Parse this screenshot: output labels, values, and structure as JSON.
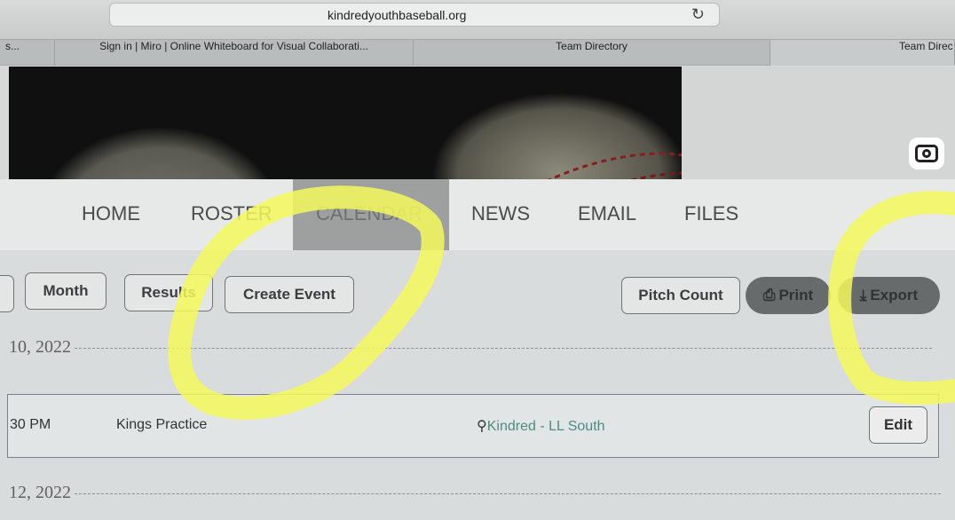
{
  "browser": {
    "url": "kindredyouthbaseball.org",
    "tabs": [
      "s...",
      "Sign in | Miro | Online Whiteboard for Visual Collaborati...",
      "Team Directory",
      "Team Direc"
    ]
  },
  "nav": {
    "items": [
      "HOME",
      "ROSTER",
      "CALENDAR",
      "NEWS",
      "EMAIL",
      "FILES"
    ]
  },
  "toolbar": {
    "month_label": "Month",
    "results_label": "Results",
    "create_event_label": "Create Event",
    "pitch_count_label": "Pitch Count",
    "print_label": "Print",
    "export_label": "Export"
  },
  "schedule": {
    "date_1": "10, 2022",
    "event": {
      "time": "30 PM",
      "name": "Kings Practice",
      "location": "Kindred - LL South",
      "edit_label": "Edit"
    },
    "date_2": "12, 2022"
  },
  "colors": {
    "highlighter": "#f4f85a",
    "location_link": "#4f8b85",
    "dark_button": "#686b6b"
  },
  "icons": [
    "reload-icon",
    "camera-icon",
    "print-icon",
    "download-icon",
    "map-marker-icon"
  ]
}
